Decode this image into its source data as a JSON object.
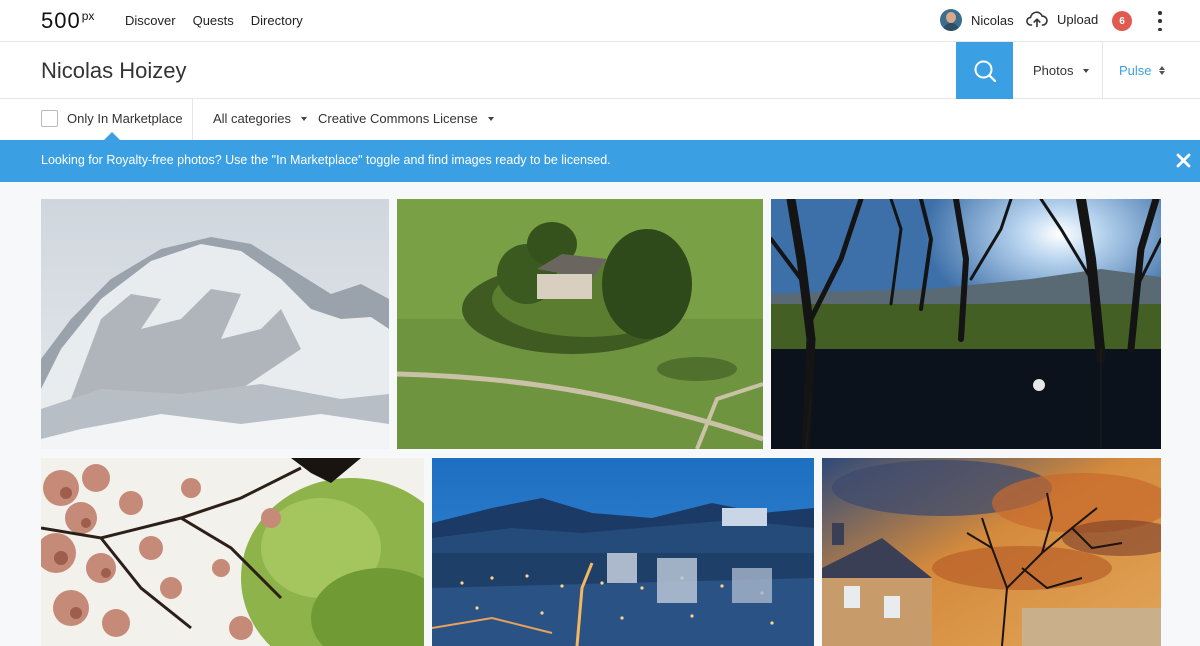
{
  "nav": {
    "logo_text": "500",
    "logo_sup": "px",
    "links": [
      "Discover",
      "Quests",
      "Directory"
    ],
    "user_name": "Nicolas",
    "upload_label": "Upload",
    "notification_count": "6"
  },
  "search": {
    "query": "Nicolas Hoizey",
    "type_label": "Photos",
    "sort_label": "Pulse"
  },
  "filters": {
    "marketplace_label": "Only In Marketplace",
    "categories_label": "All categories",
    "license_label": "Creative Commons License"
  },
  "banner": {
    "message": "Looking for Royalty-free photos? Use the \"In Marketplace\" toggle and find images ready to be licensed."
  },
  "colors": {
    "accent": "#3ba0e3",
    "badge": "#e05a4f"
  },
  "photos": [
    {
      "subject": "snowy-mountain"
    },
    {
      "subject": "house-in-field"
    },
    {
      "subject": "trees-by-pond"
    },
    {
      "subject": "cherry-blossoms"
    },
    {
      "subject": "city-at-dusk"
    },
    {
      "subject": "sunset-building"
    }
  ]
}
